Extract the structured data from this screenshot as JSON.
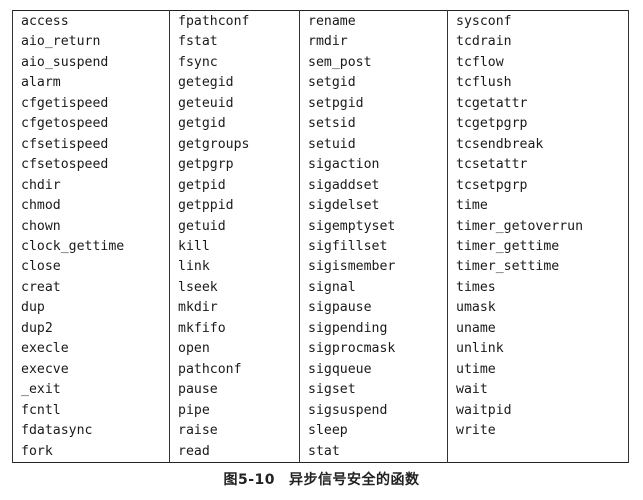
{
  "table": {
    "rows": [
      [
        "access",
        "fpathconf",
        "rename",
        "sysconf"
      ],
      [
        "aio_return",
        "fstat",
        "rmdir",
        "tcdrain"
      ],
      [
        "aio_suspend",
        "fsync",
        "sem_post",
        "tcflow"
      ],
      [
        "alarm",
        "getegid",
        "setgid",
        "tcflush"
      ],
      [
        "cfgetispeed",
        "geteuid",
        "setpgid",
        "tcgetattr"
      ],
      [
        "cfgetospeed",
        "getgid",
        "setsid",
        "tcgetpgrp"
      ],
      [
        "cfsetispeed",
        "getgroups",
        "setuid",
        "tcsendbreak"
      ],
      [
        "cfsetospeed",
        "getpgrp",
        "sigaction",
        "tcsetattr"
      ],
      [
        "chdir",
        "getpid",
        "sigaddset",
        "tcsetpgrp"
      ],
      [
        "chmod",
        "getppid",
        "sigdelset",
        "time"
      ],
      [
        "chown",
        "getuid",
        "sigemptyset",
        "timer_getoverrun"
      ],
      [
        "clock_gettime",
        "kill",
        "sigfillset",
        "timer_gettime"
      ],
      [
        "close",
        "link",
        "sigismember",
        "timer_settime"
      ],
      [
        "creat",
        "lseek",
        "signal",
        "times"
      ],
      [
        "dup",
        "mkdir",
        "sigpause",
        "umask"
      ],
      [
        "dup2",
        "mkfifo",
        "sigpending",
        "uname"
      ],
      [
        "execle",
        "open",
        "sigprocmask",
        "unlink"
      ],
      [
        "execve",
        "pathconf",
        "sigqueue",
        "utime"
      ],
      [
        "_exit",
        "pause",
        "sigset",
        "wait"
      ],
      [
        "fcntl",
        "pipe",
        "sigsuspend",
        "waitpid"
      ],
      [
        "fdatasync",
        "raise",
        "sleep",
        "write"
      ],
      [
        "fork",
        "read",
        "stat",
        ""
      ]
    ]
  },
  "caption": {
    "number": "图5-10",
    "title": "异步信号安全的函数"
  }
}
